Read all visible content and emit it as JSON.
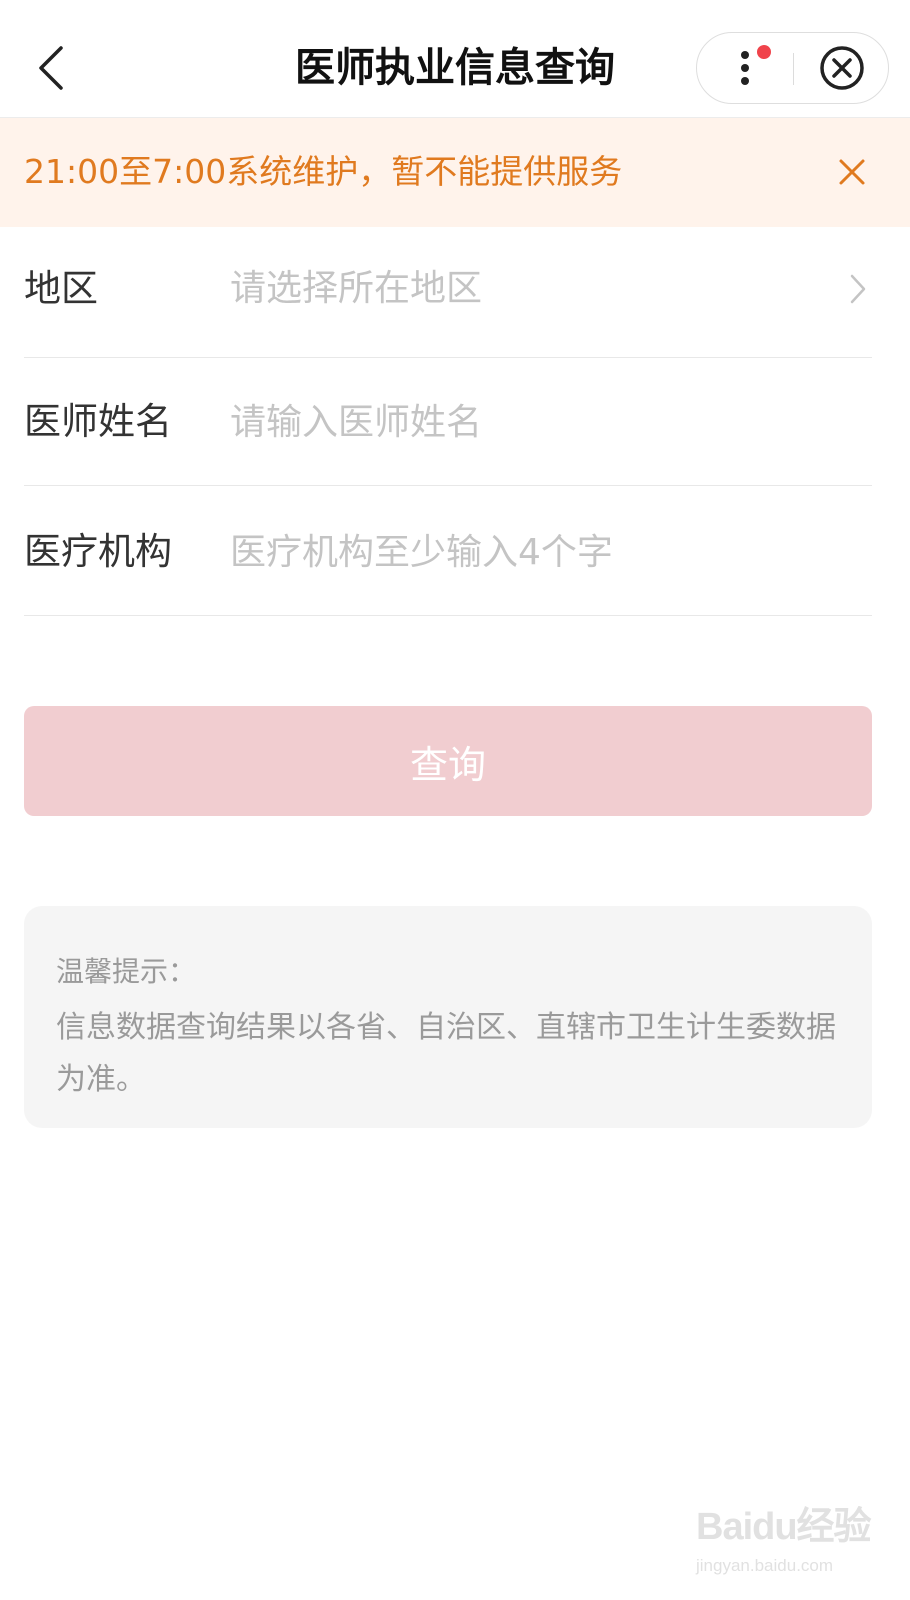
{
  "header": {
    "title": "医师执业信息查询",
    "back_icon": "chevron-left-icon",
    "more_icon": "more-vertical-icon",
    "close_icon": "close-circle-icon",
    "has_notification_dot": true
  },
  "notice": {
    "text": "21:00至7:00系统维护，暂不能提供服务",
    "close_icon": "close-icon",
    "color": "#e07a1f",
    "background": "#fff3eb"
  },
  "form": {
    "region": {
      "label": "地区",
      "placeholder": "请选择所在地区",
      "icon": "chevron-right-icon"
    },
    "doctor_name": {
      "label": "医师姓名",
      "placeholder": "请输入医师姓名",
      "value": ""
    },
    "institution": {
      "label": "医疗机构",
      "placeholder": "医疗机构至少输入4个字",
      "value": ""
    }
  },
  "query_button": {
    "label": "查询",
    "color": "#f1cdd0",
    "disabled_look": true
  },
  "tips": {
    "title": "温馨提示：",
    "body": "信息数据查询结果以各省、自治区、直辖市卫生计生委数据为准。"
  },
  "watermark": {
    "logo": "Baidu经验",
    "url": "jingyan.baidu.com"
  }
}
